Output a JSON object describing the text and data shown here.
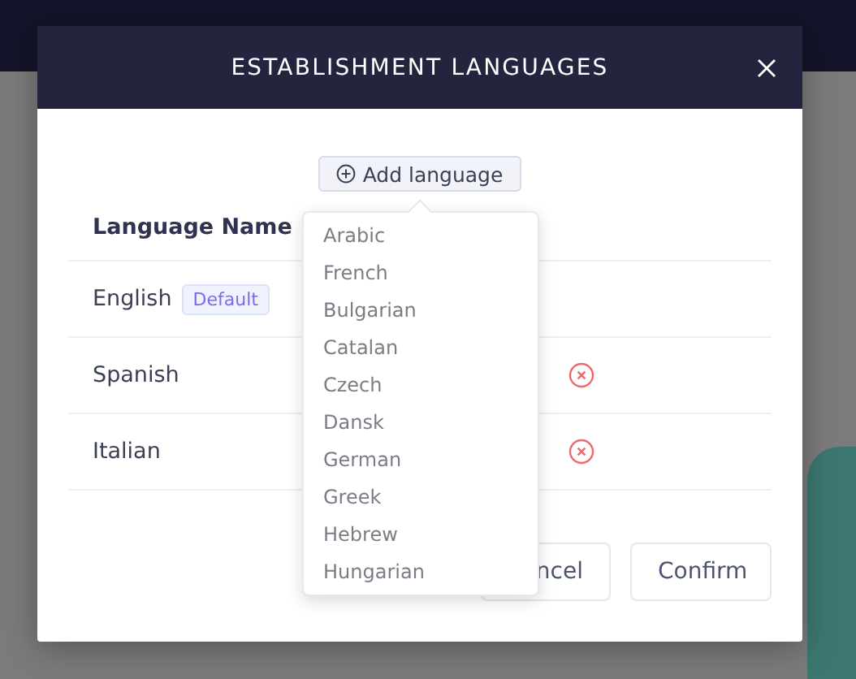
{
  "modal": {
    "title": "ESTABLISHMENT LANGUAGES",
    "add_button": "Add language",
    "column": "Language Name",
    "rows": [
      {
        "name": "English",
        "badge": "Default",
        "removable": false
      },
      {
        "name": "Spanish",
        "removable": true
      },
      {
        "name": "Italian",
        "removable": true
      }
    ],
    "buttons": [
      "ncel",
      "Confirm"
    ]
  },
  "dropdown": {
    "expanded": true,
    "items": [
      "Arabic",
      "French",
      "Bulgarian",
      "Catalan",
      "Czech",
      "Dansk",
      "German",
      "Greek",
      "Hebrew",
      "Hungarian"
    ]
  }
}
